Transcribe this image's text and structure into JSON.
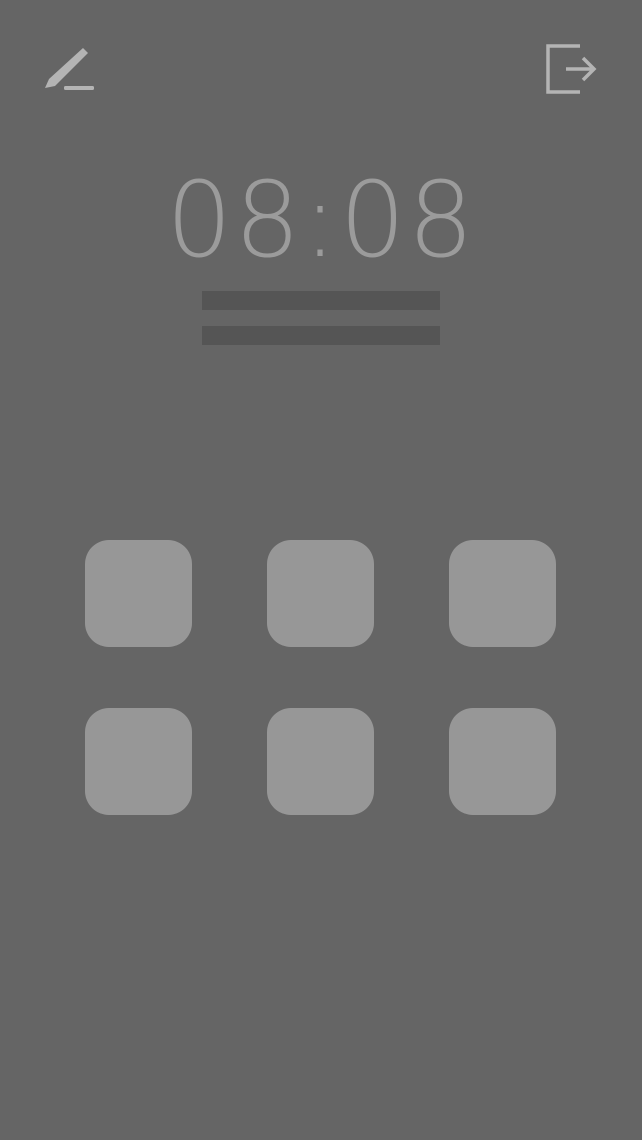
{
  "header": {
    "left_icon": "pencil-edit-icon",
    "right_icon": "logout-icon"
  },
  "clock": {
    "time": "08:08"
  },
  "colors": {
    "background": "#656565",
    "tile": "#979797",
    "icon": "#b4b4b4",
    "clock_text": "#9b9b9b",
    "placeholder_bar": "#555555"
  },
  "tiles": [
    {
      "icon": "app-tile"
    },
    {
      "icon": "app-tile"
    },
    {
      "icon": "app-tile"
    },
    {
      "icon": "app-tile"
    },
    {
      "icon": "app-tile"
    },
    {
      "icon": "app-tile"
    }
  ]
}
